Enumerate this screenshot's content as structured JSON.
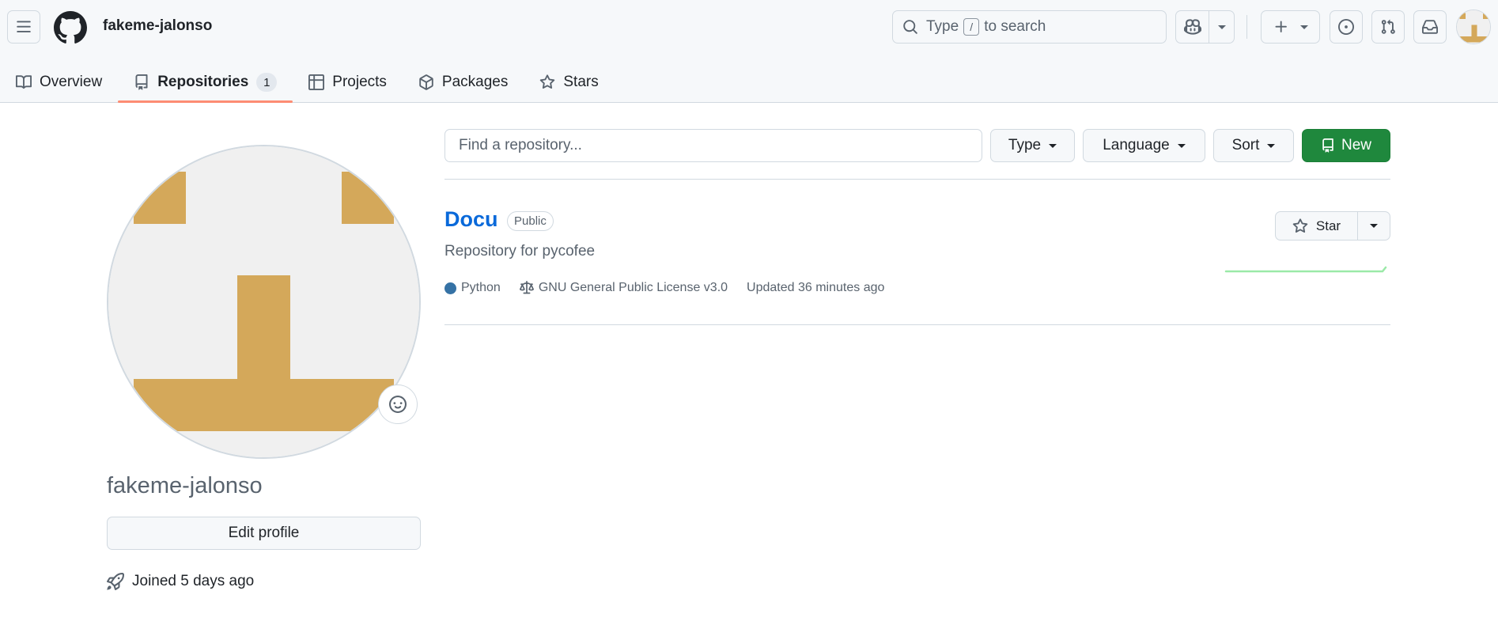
{
  "header": {
    "owner": "fakeme-jalonso",
    "search": {
      "prefix": "Type",
      "key": "/",
      "suffix": "to search"
    },
    "icons": [
      "menu-icon",
      "github-logo-icon",
      "search-icon",
      "copilot-icon",
      "plus-icon",
      "issue-opened-icon",
      "git-pull-request-icon",
      "inbox-icon"
    ]
  },
  "tabs": [
    {
      "label": "Overview",
      "icon": "book-icon"
    },
    {
      "label": "Repositories",
      "icon": "repo-icon",
      "counter": "1",
      "selected": true
    },
    {
      "label": "Projects",
      "icon": "table-icon"
    },
    {
      "label": "Packages",
      "icon": "package-icon"
    },
    {
      "label": "Stars",
      "icon": "star-icon"
    }
  ],
  "profile": {
    "username": "fakeme-jalonso",
    "edit_label": "Edit profile",
    "joined": "Joined 5 days ago",
    "avatar_colors": {
      "fg": "#d4a85a",
      "bg": "#f0f0f0"
    }
  },
  "filters": {
    "search_placeholder": "Find a repository...",
    "type_label": "Type",
    "language_label": "Language",
    "sort_label": "Sort",
    "new_label": "New"
  },
  "repo": {
    "name": "Docu",
    "visibility": "Public",
    "description": "Repository for pycofee",
    "language": "Python",
    "language_color": "#3572A5",
    "license": "GNU General Public License v3.0",
    "updated": "Updated 36 minutes ago",
    "star_label": "Star"
  },
  "colors": {
    "accent_tab": "#fd8c73",
    "link": "#0969da",
    "primary_button": "#1f883d"
  }
}
